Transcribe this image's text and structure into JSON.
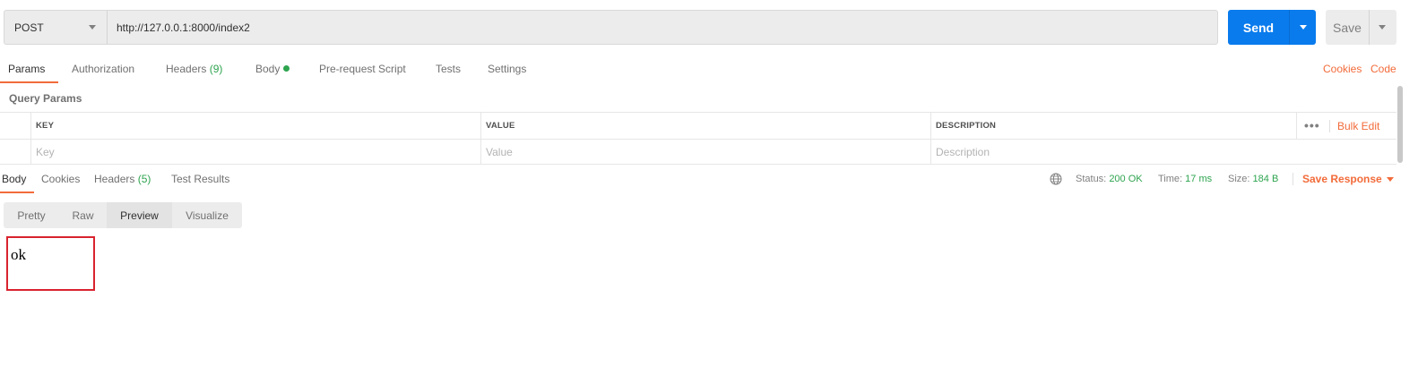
{
  "request": {
    "method": "POST",
    "url": "http://127.0.0.1:8000/index2",
    "send_label": "Send",
    "save_label": "Save"
  },
  "request_tabs": {
    "params": "Params",
    "authorization": "Authorization",
    "headers": "Headers",
    "headers_count": "(9)",
    "body": "Body",
    "pre_request": "Pre-request Script",
    "tests": "Tests",
    "settings": "Settings"
  },
  "links": {
    "cookies": "Cookies",
    "code": "Code"
  },
  "query_params": {
    "title": "Query Params",
    "columns": [
      "KEY",
      "VALUE",
      "DESCRIPTION"
    ],
    "placeholders": [
      "Key",
      "Value",
      "Description"
    ],
    "bulk_edit": "Bulk Edit",
    "more": "•••"
  },
  "response_tabs": {
    "body": "Body",
    "cookies": "Cookies",
    "headers": "Headers",
    "headers_count": "(5)",
    "test_results": "Test Results"
  },
  "response_meta": {
    "status_label": "Status:",
    "status_value": "200 OK",
    "time_label": "Time:",
    "time_value": "17 ms",
    "size_label": "Size:",
    "size_value": "184 B",
    "save_response": "Save Response"
  },
  "view_modes": [
    "Pretty",
    "Raw",
    "Preview",
    "Visualize"
  ],
  "active_view_mode": "Preview",
  "preview": {
    "content": "ok"
  },
  "colors": {
    "accent": "#f26b3a",
    "send": "#097bed",
    "success": "#2ea44f",
    "highlight_box": "#d9232f"
  }
}
